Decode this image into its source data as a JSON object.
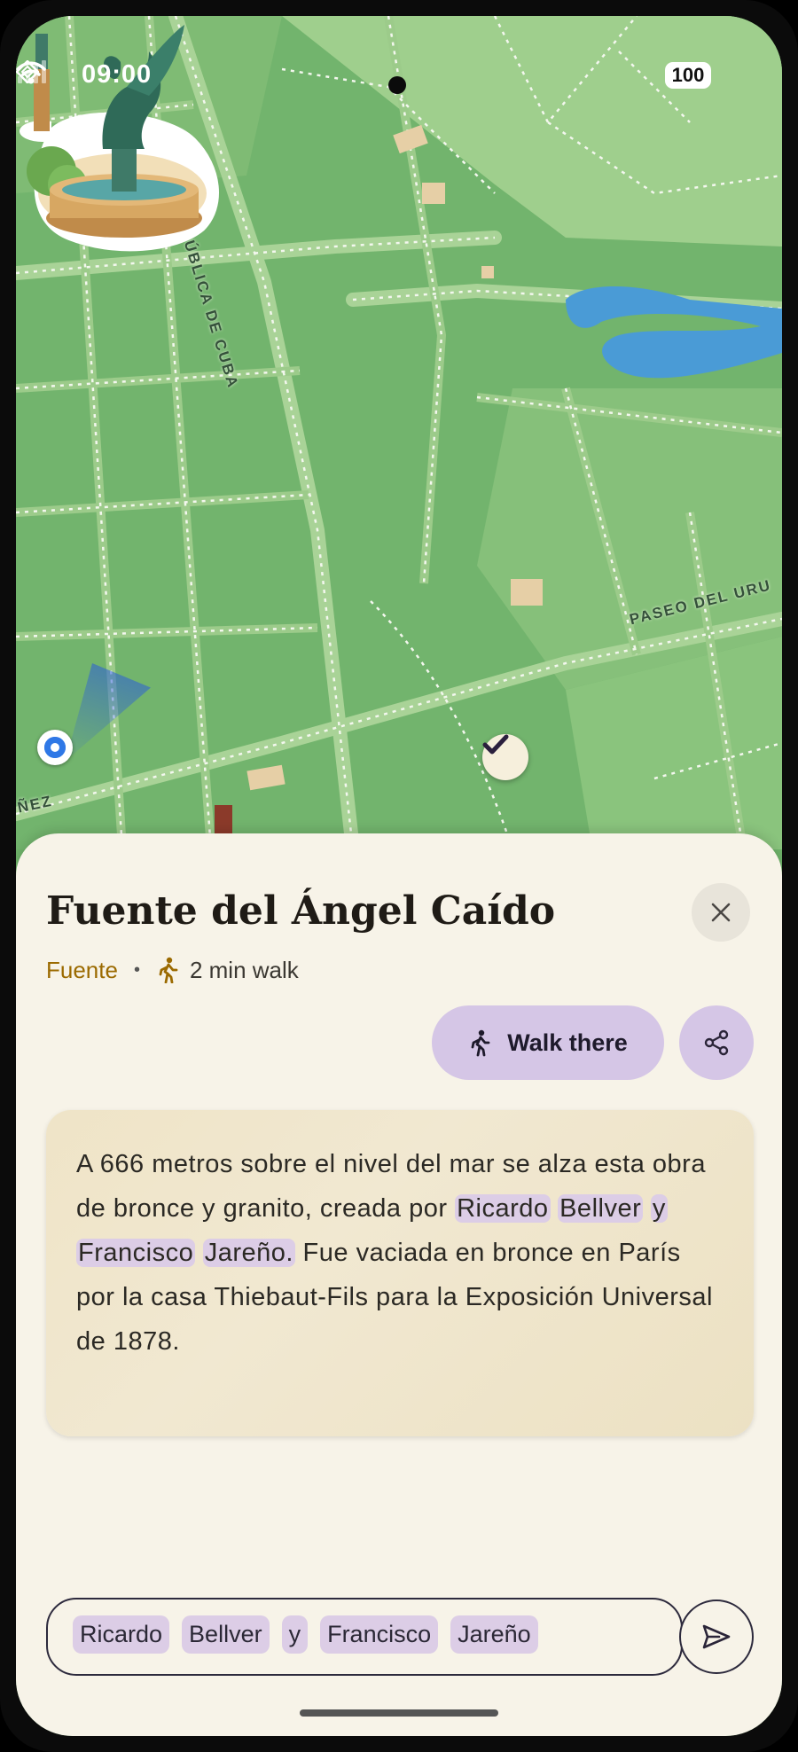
{
  "status_bar": {
    "time": "09:00",
    "battery": "100"
  },
  "map": {
    "streets": [
      "PASEO REPÚBLICA DE CUBA",
      "PASEO DEL URU",
      "ÑEZ"
    ]
  },
  "place": {
    "title": "Fuente del Ángel Caído",
    "category": "Fuente",
    "separator": "•",
    "walk_time": "2 min walk",
    "visited": true
  },
  "actions": {
    "walk_label": "Walk there"
  },
  "description": {
    "part1": "A 666 metros sobre el nivel del mar se alza esta obra de bronce y granito, creada por ",
    "highlighted": [
      "Ricardo",
      "Bellver",
      "y",
      "Francisco",
      "Jareño."
    ],
    "part2": " Fue vaciada en bronce en París por la casa Thiebaut-Fils para la Exposición Universal de 1878."
  },
  "input": {
    "chips": [
      "Ricardo",
      "Bellver",
      "y",
      "Francisco",
      "Jareño"
    ]
  },
  "colors": {
    "sheet_bg": "#f7f3e8",
    "accent_lavender": "#d5c6e6",
    "category": "#9b6a00",
    "map_green": "#6fb36a"
  }
}
